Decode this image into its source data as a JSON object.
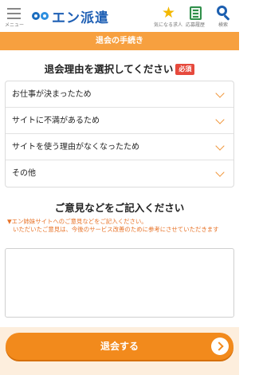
{
  "header": {
    "menu_label": "メニュー",
    "logo_text": "エン派遣",
    "favorites_label": "気になる求人",
    "history_label": "応募履歴",
    "search_label": "検索"
  },
  "banner": {
    "title": "退会の手続き"
  },
  "reasons_section": {
    "title": "退会理由を選択してください",
    "required_badge": "必須",
    "items": [
      {
        "label": "お仕事が決まったため"
      },
      {
        "label": "サイトに不満があるため"
      },
      {
        "label": "サイトを使う理由がなくなったため"
      },
      {
        "label": "その他"
      }
    ]
  },
  "comment_section": {
    "title": "ご意見などをご記入ください",
    "note_line1": "▼エン姉妹サイトへのご意見などをご記入ください。",
    "note_line2": "いただいたご意見は、今後のサービス改善のために参考にさせていただきます",
    "placeholder": ""
  },
  "footer": {
    "submit_label": "退会する"
  },
  "colors": {
    "accent_orange": "#f7a03f",
    "button_orange": "#f28a1c",
    "required_red": "#e64a3d",
    "brand_blue": "#1e5fb4"
  },
  "icons": [
    "menu-icon",
    "star-icon",
    "history-icon",
    "search-icon",
    "chevron-down-icon",
    "arrow-right-icon"
  ]
}
